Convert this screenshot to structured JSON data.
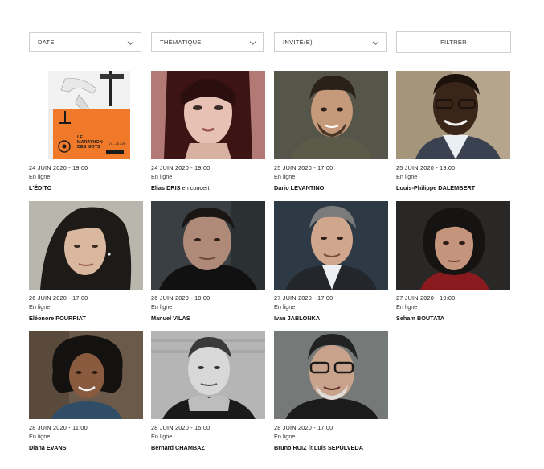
{
  "filters": [
    {
      "label": "DATE",
      "type": "select"
    },
    {
      "label": "THÉMATIQUE",
      "type": "select"
    },
    {
      "label": "INVITÉ(E)",
      "type": "select"
    },
    {
      "label": "FILTRER",
      "type": "button"
    }
  ],
  "poster": {
    "line1": "LE",
    "line2": "MARATHON",
    "line3": "DES MOTS",
    "dates": "24 – 28 JUIN"
  },
  "events": [
    {
      "date": "24 JUIN 2020 - 19:00",
      "place": "En ligne",
      "name": "L'ÉDITO",
      "name_mid": "",
      "name_end": ""
    },
    {
      "date": "24 JUIN 2020 - 19:00",
      "place": "En ligne",
      "name": "Elias DRIS",
      "name_mid": " en concert",
      "name_end": ""
    },
    {
      "date": "25 JUIN 2020 - 17:00",
      "place": "En ligne",
      "name": "Dario LEVANTINO",
      "name_mid": "",
      "name_end": ""
    },
    {
      "date": "25 JUIN 2020 - 19:00",
      "place": "En ligne",
      "name": "Louis-Philippe DALEMBERT",
      "name_mid": "",
      "name_end": ""
    },
    {
      "date": "26 JUIN 2020 - 17:00",
      "place": "En ligne",
      "name": "Éléonore POURRIAT",
      "name_mid": "",
      "name_end": ""
    },
    {
      "date": "26 JUIN 2020 - 19:00",
      "place": "En ligne",
      "name": "Manuel VILAS",
      "name_mid": "",
      "name_end": ""
    },
    {
      "date": "27 JUIN 2020 - 17:00",
      "place": "En ligne",
      "name": "Ivan JABLONKA",
      "name_mid": "",
      "name_end": ""
    },
    {
      "date": "27 JUIN 2020 - 19:00",
      "place": "En ligne",
      "name": "Seham BOUTATA",
      "name_mid": "",
      "name_end": ""
    },
    {
      "date": "28 JUIN 2020 - 11:00",
      "place": "En ligne",
      "name": "Diana EVANS",
      "name_mid": "",
      "name_end": ""
    },
    {
      "date": "28 JUIN 2020 - 15:00",
      "place": "En ligne",
      "name": "Bernard CHAMBAZ",
      "name_mid": "",
      "name_end": ""
    },
    {
      "date": "28 JUIN 2020 - 17:00",
      "place": "En ligne",
      "name": "Bruno RUIZ",
      "name_mid": " lit ",
      "name_end": "Luis SEPÚLVEDA"
    }
  ],
  "colors": {
    "poster_orange": "#f07a2a",
    "border": "#cfcfcf"
  }
}
